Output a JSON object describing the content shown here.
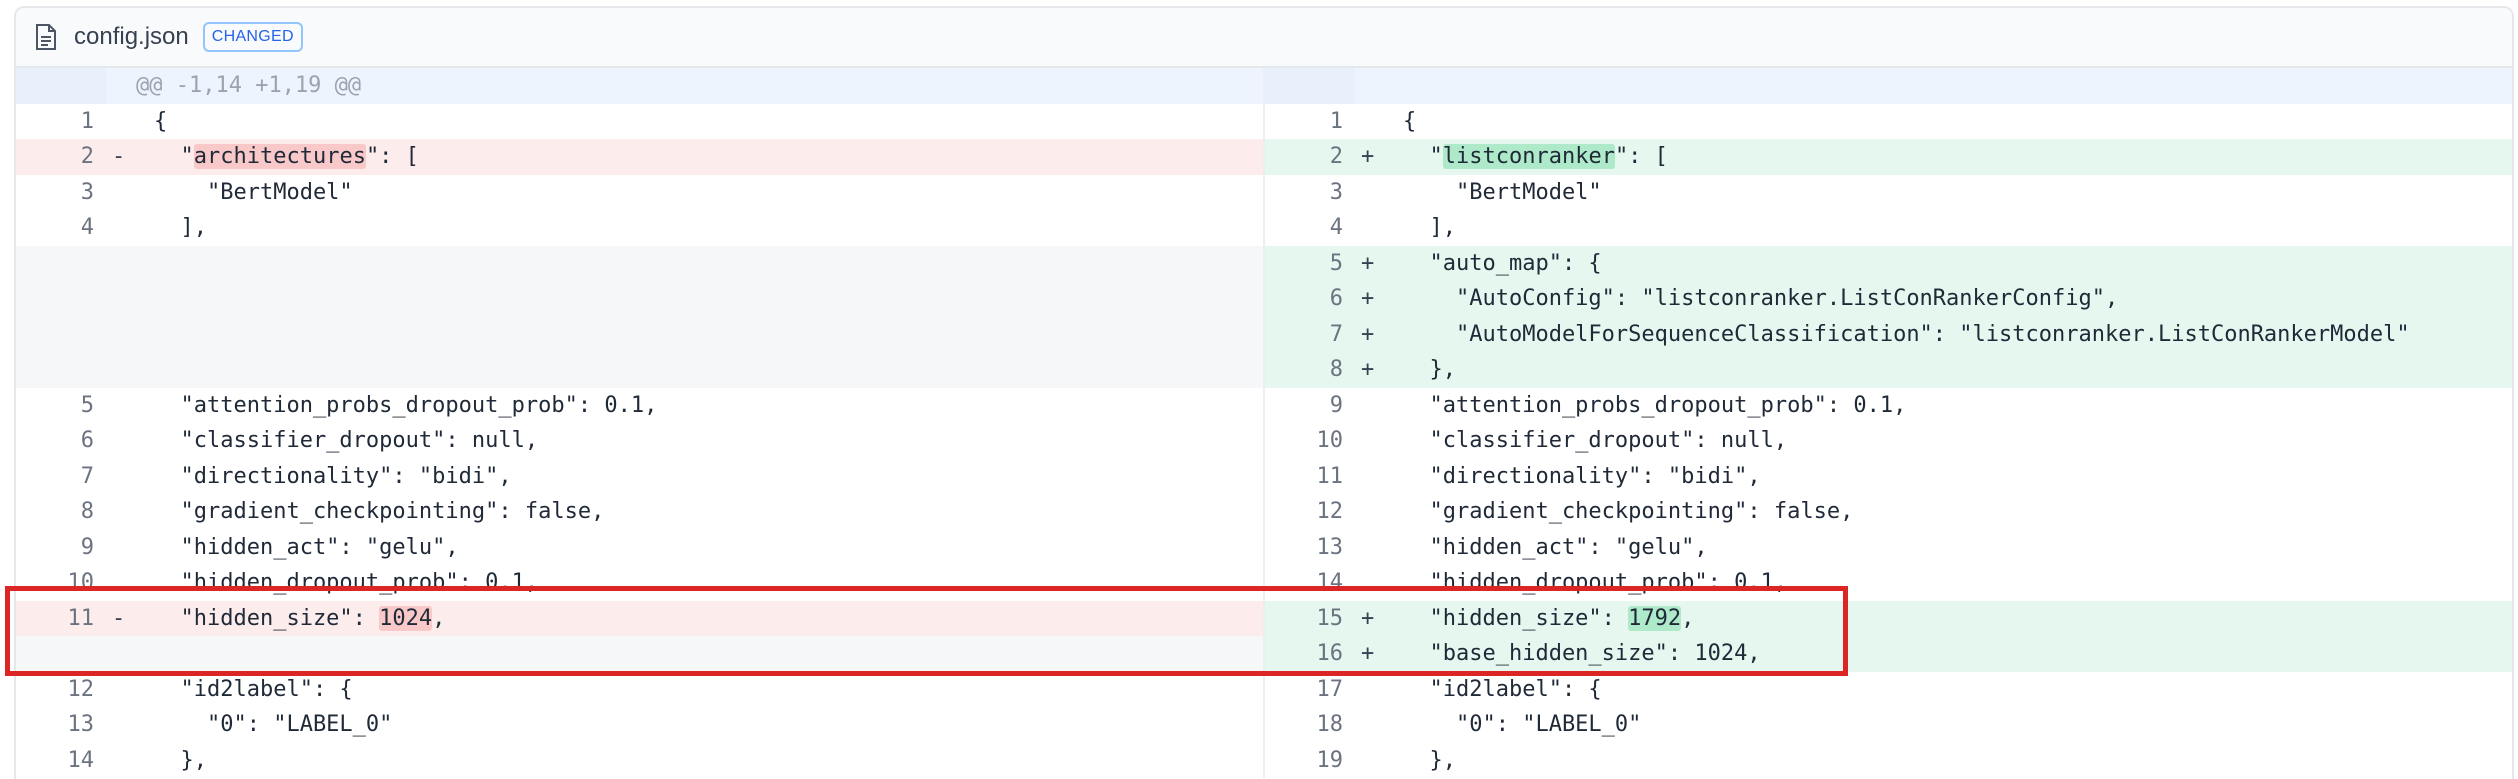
{
  "file": {
    "name": "config.json",
    "status": "CHANGED",
    "icon": "file-icon"
  },
  "hunk_header": "@@ -1,14 +1,19 @@",
  "rows": [
    {
      "type": "ctx",
      "left_no": "1",
      "left": "{",
      "right_no": "1",
      "right": "{"
    },
    {
      "type": "mod",
      "left_no": "2",
      "left_pre": "  \"",
      "left_hl": "architectures",
      "left_post": "\": [",
      "right_no": "2",
      "right_pre": "  \"",
      "right_hl": "listconranker",
      "right_post": "\": ["
    },
    {
      "type": "ctx",
      "left_no": "3",
      "left": "    \"BertModel\"",
      "right_no": "3",
      "right": "    \"BertModel\""
    },
    {
      "type": "ctx",
      "left_no": "4",
      "left": "  ],",
      "right_no": "4",
      "right": "  ],"
    },
    {
      "type": "addonly",
      "right_no": "5",
      "right": "  \"auto_map\": {"
    },
    {
      "type": "addonly",
      "right_no": "6",
      "right": "    \"AutoConfig\": \"listconranker.ListConRankerConfig\","
    },
    {
      "type": "addonly",
      "right_no": "7",
      "right": "    \"AutoModelForSequenceClassification\": \"listconranker.ListConRankerModel\""
    },
    {
      "type": "addonly",
      "right_no": "8",
      "right": "  },"
    },
    {
      "type": "ctx",
      "left_no": "5",
      "left": "  \"attention_probs_dropout_prob\": 0.1,",
      "right_no": "9",
      "right": "  \"attention_probs_dropout_prob\": 0.1,"
    },
    {
      "type": "ctx",
      "left_no": "6",
      "left": "  \"classifier_dropout\": null,",
      "right_no": "10",
      "right": "  \"classifier_dropout\": null,"
    },
    {
      "type": "ctx",
      "left_no": "7",
      "left": "  \"directionality\": \"bidi\",",
      "right_no": "11",
      "right": "  \"directionality\": \"bidi\","
    },
    {
      "type": "ctx",
      "left_no": "8",
      "left": "  \"gradient_checkpointing\": false,",
      "right_no": "12",
      "right": "  \"gradient_checkpointing\": false,"
    },
    {
      "type": "ctx",
      "left_no": "9",
      "left": "  \"hidden_act\": \"gelu\",",
      "right_no": "13",
      "right": "  \"hidden_act\": \"gelu\","
    },
    {
      "type": "ctx",
      "left_no": "10",
      "left": "  \"hidden_dropout_prob\": 0.1,",
      "right_no": "14",
      "right": "  \"hidden_dropout_prob\": 0.1,"
    },
    {
      "type": "mod",
      "left_no": "11",
      "left_pre": "  \"hidden_size\": ",
      "left_hl": "1024",
      "left_post": ",",
      "right_no": "15",
      "right_pre": "  \"hidden_size\": ",
      "right_hl": "1792",
      "right_post": ","
    },
    {
      "type": "addonly",
      "right_no": "16",
      "right": "  \"base_hidden_size\": 1024,"
    },
    {
      "type": "ctx",
      "left_no": "12",
      "left": "  \"id2label\": {",
      "right_no": "17",
      "right": "  \"id2label\": {"
    },
    {
      "type": "ctx",
      "left_no": "13",
      "left": "    \"0\": \"LABEL_0\"",
      "right_no": "18",
      "right": "    \"0\": \"LABEL_0\""
    },
    {
      "type": "ctx",
      "left_no": "14",
      "left": "  },",
      "right_no": "19",
      "right": "  },"
    }
  ],
  "markers": {
    "del": "-",
    "add": "+"
  },
  "colors": {
    "deletion_bg": "#fdecec",
    "addition_bg": "#e6f7ef",
    "deletion_highlight": "#f9c9c9",
    "addition_highlight": "#aeeac9",
    "annotation_box": "#dc2626",
    "badge": "#2563eb"
  }
}
